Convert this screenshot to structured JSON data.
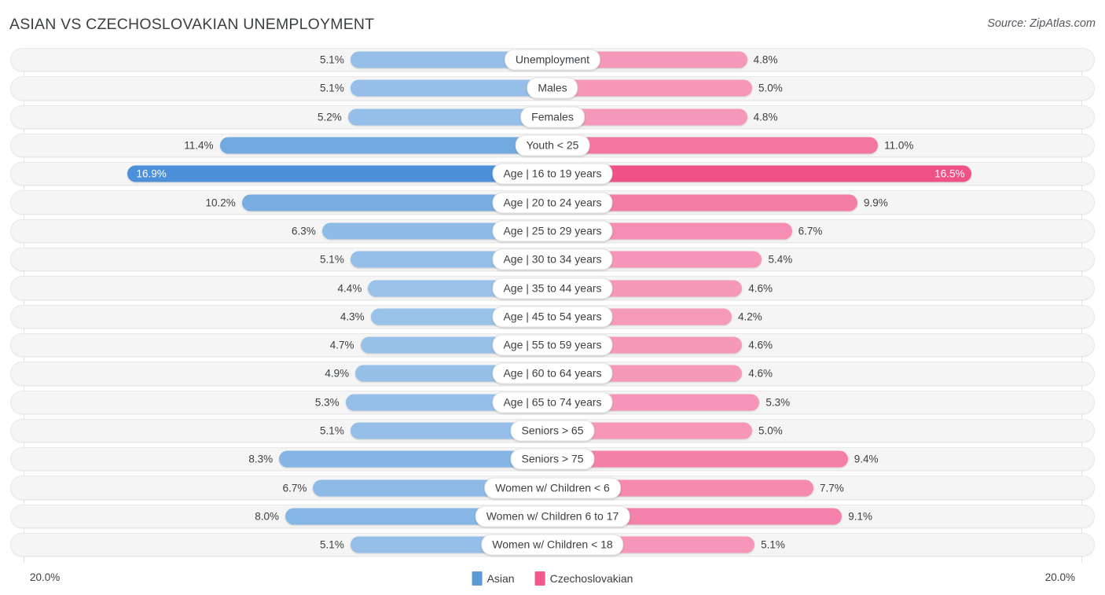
{
  "header": {
    "title": "ASIAN VS CZECHOSLOVAKIAN UNEMPLOYMENT",
    "source": "Source: ZipAtlas.com"
  },
  "legend": {
    "left": {
      "label": "Asian",
      "color": "#5b9bd5"
    },
    "right": {
      "label": "Czechoslovakian",
      "color": "#f2588a"
    }
  },
  "axis": {
    "min_label": "20.0%",
    "max_label": "20.0%",
    "max_value": 20.0
  },
  "chart_data": {
    "type": "bar",
    "orientation": "horizontal-diverging",
    "title": "ASIAN VS CZECHOSLOVAKIAN UNEMPLOYMENT",
    "xlabel": "",
    "ylabel": "",
    "xlim": [
      20.0,
      20.0
    ],
    "grid": true,
    "legend_position": "bottom-center",
    "units": "percent",
    "categories": [
      "Unemployment",
      "Males",
      "Females",
      "Youth < 25",
      "Age | 16 to 19 years",
      "Age | 20 to 24 years",
      "Age | 25 to 29 years",
      "Age | 30 to 34 years",
      "Age | 35 to 44 years",
      "Age | 45 to 54 years",
      "Age | 55 to 59 years",
      "Age | 60 to 64 years",
      "Age | 65 to 74 years",
      "Seniors > 65",
      "Seniors > 75",
      "Women w/ Children < 6",
      "Women w/ Children 6 to 17",
      "Women w/ Children < 18"
    ],
    "series": [
      {
        "name": "Asian",
        "color": "#5b9bd5",
        "values": [
          5.1,
          5.1,
          5.2,
          11.4,
          16.9,
          10.2,
          6.3,
          5.1,
          4.4,
          4.3,
          4.7,
          4.9,
          5.3,
          5.1,
          8.3,
          6.7,
          8.0,
          5.1
        ],
        "labels": [
          "5.1%",
          "5.1%",
          "5.2%",
          "11.4%",
          "16.9%",
          "10.2%",
          "6.3%",
          "5.1%",
          "4.4%",
          "4.3%",
          "4.7%",
          "4.9%",
          "5.3%",
          "5.1%",
          "8.3%",
          "6.7%",
          "8.0%",
          "5.1%"
        ]
      },
      {
        "name": "Czechoslovakian",
        "color": "#f2588a",
        "values": [
          4.8,
          5.0,
          4.8,
          11.0,
          16.5,
          9.9,
          6.7,
          5.4,
          4.6,
          4.2,
          4.6,
          4.6,
          5.3,
          5.0,
          9.4,
          7.7,
          9.1,
          5.1
        ],
        "labels": [
          "4.8%",
          "5.0%",
          "4.8%",
          "11.0%",
          "16.5%",
          "9.9%",
          "6.7%",
          "5.4%",
          "4.6%",
          "4.2%",
          "4.6%",
          "4.6%",
          "5.3%",
          "5.0%",
          "9.4%",
          "7.7%",
          "9.1%",
          "5.1%"
        ]
      }
    ],
    "highlighted_row": "Age | 16 to 19 years"
  }
}
